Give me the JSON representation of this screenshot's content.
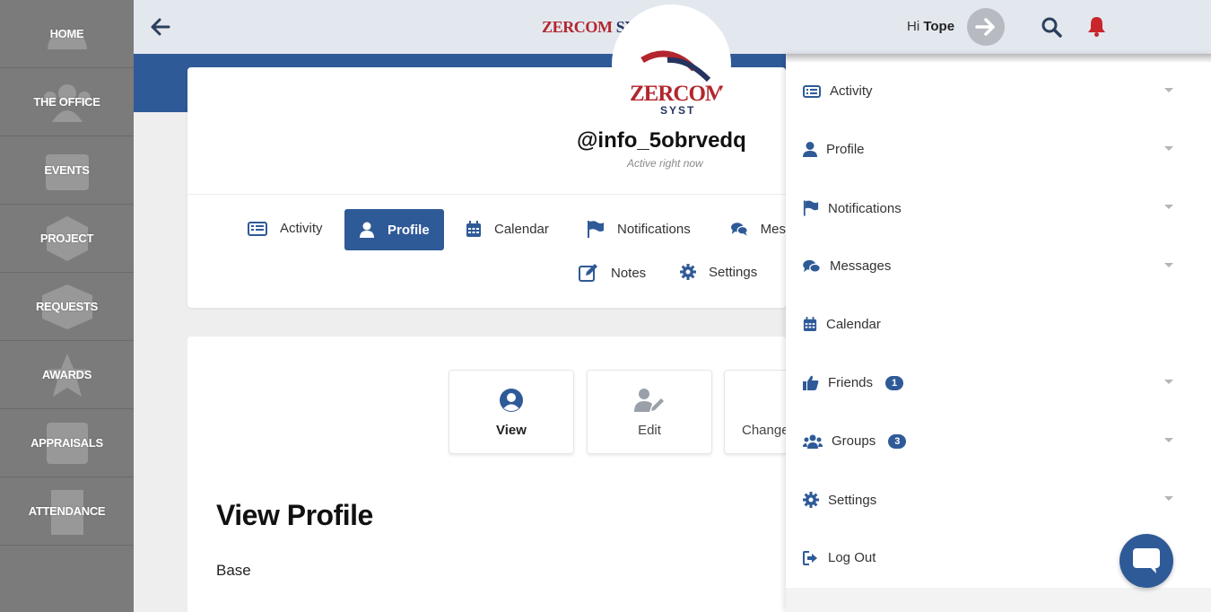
{
  "colors": {
    "accent": "#2f5a98",
    "sidebar": "#7b7b7b",
    "brand_red": "#b3262d",
    "brand_navy": "#25335f",
    "bell": "#c9262b"
  },
  "sidebar": {
    "items": [
      {
        "label": "HOME",
        "icon": "dashboard-icon"
      },
      {
        "label": "THE OFFICE",
        "icon": "users-icon"
      },
      {
        "label": "EVENTS",
        "icon": "calendar-icon"
      },
      {
        "label": "PROJECT",
        "icon": "cubes-icon"
      },
      {
        "label": "REQUESTS",
        "icon": "box-icon"
      },
      {
        "label": "AWARDS",
        "icon": "star-icon"
      },
      {
        "label": "APPRAISALS",
        "icon": "grade-icon"
      },
      {
        "label": "ATTENDANCE",
        "icon": "building-icon"
      }
    ]
  },
  "header": {
    "brand_first": "ZERCOM",
    "brand_second": " SYSTEMS",
    "greeting": "Hi",
    "user": "Tope"
  },
  "avatar": {
    "logo_text": "ZERCOM",
    "logo_sub": "SYST"
  },
  "profile": {
    "username": "@info_5obrvedq",
    "status": "Active right now",
    "tabs": [
      {
        "label": "Activity",
        "icon": "activity-icon"
      },
      {
        "label": "Profile",
        "icon": "user-icon"
      },
      {
        "label": "Calendar",
        "icon": "calendar-icon"
      },
      {
        "label": "Notifications",
        "icon": "flag-icon"
      },
      {
        "label": "Mes",
        "icon": "comments-icon"
      },
      {
        "label": "Notes",
        "icon": "edit-icon"
      },
      {
        "label": "Settings",
        "icon": "gear-icon"
      }
    ]
  },
  "view_buttons": [
    {
      "label": "View",
      "icon": "user-circle-icon"
    },
    {
      "label": "Edit",
      "icon": "user-edit-icon"
    },
    {
      "label": "Change",
      "icon": "image-icon"
    }
  ],
  "content": {
    "heading": "View Profile",
    "section_label": "Base"
  },
  "dropdown": {
    "items": [
      {
        "label": "Activity",
        "icon": "activity-icon",
        "has_caret": true
      },
      {
        "label": "Profile",
        "icon": "user-icon",
        "has_caret": true
      },
      {
        "label": "Notifications",
        "icon": "flag-icon",
        "has_caret": true
      },
      {
        "label": "Messages",
        "icon": "comments-icon",
        "has_caret": true
      },
      {
        "label": "Calendar",
        "icon": "calendar-icon",
        "has_caret": false
      },
      {
        "label": "Friends",
        "icon": "thumbs-up-icon",
        "has_caret": true,
        "badge": "1"
      },
      {
        "label": "Groups",
        "icon": "users-icon",
        "has_caret": true,
        "badge": "3"
      },
      {
        "label": "Settings",
        "icon": "gear-icon",
        "has_caret": true
      },
      {
        "label": "Log Out",
        "icon": "sign-out-icon",
        "has_caret": false
      }
    ]
  }
}
